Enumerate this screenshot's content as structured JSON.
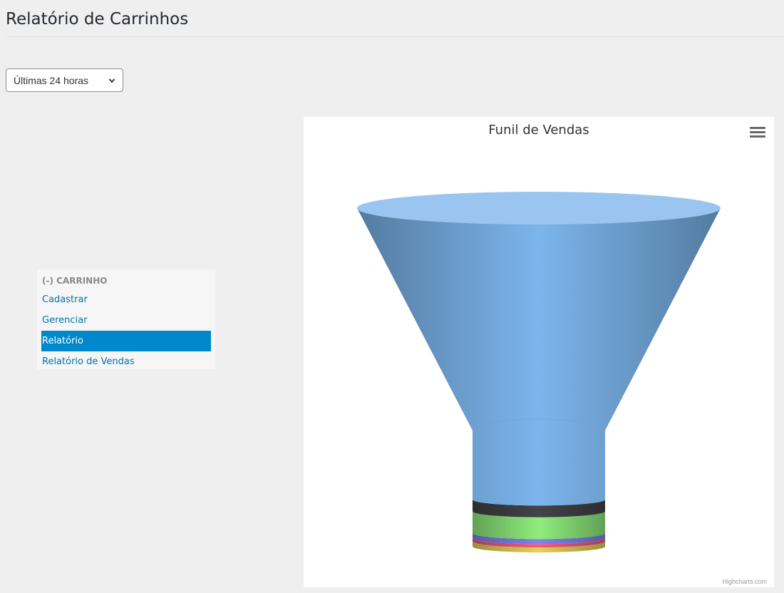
{
  "page": {
    "title": "Relatório de Carrinhos"
  },
  "filter": {
    "selected": "Últimas 24 horas"
  },
  "sidebar": {
    "header": "(-) CARRINHO",
    "items": [
      {
        "label": "Cadastrar",
        "active": false
      },
      {
        "label": "Gerenciar",
        "active": false
      },
      {
        "label": "Relatório",
        "active": true
      },
      {
        "label": "Relatório de Vendas",
        "active": false
      }
    ]
  },
  "chart": {
    "title": "Funil de Vendas",
    "credits": "Highcharts.com",
    "export_icon": "hamburger-menu-icon"
  },
  "chart_data": {
    "type": "funnel",
    "title": "Funil de Vendas",
    "segments": [
      {
        "share": 0.87,
        "color": "#7cb5ec"
      },
      {
        "share": 0.035,
        "color": "#434348"
      },
      {
        "share": 0.065,
        "color": "#90ed7d"
      },
      {
        "share": 0.015,
        "color": "#8085e9"
      },
      {
        "share": 0.01,
        "color": "#f15c80"
      },
      {
        "share": 0.015,
        "color": "#e4d354"
      }
    ]
  }
}
